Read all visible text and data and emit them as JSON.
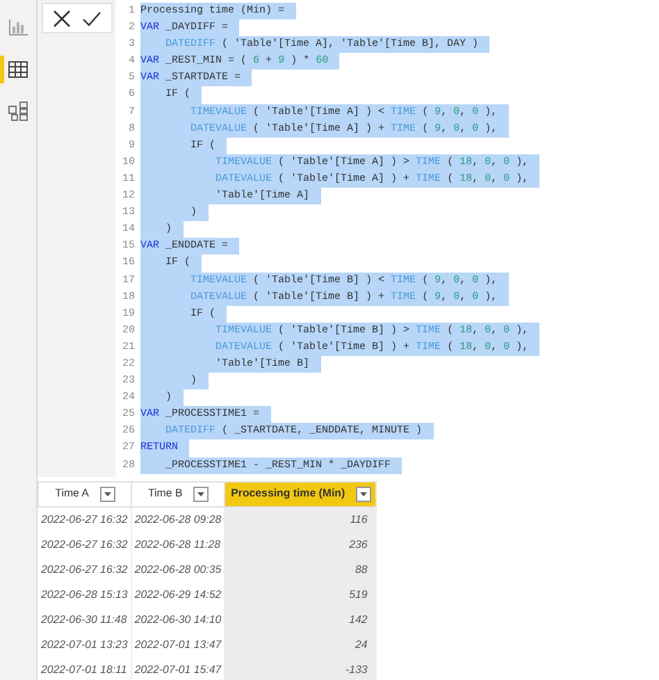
{
  "sidebar": {
    "items": [
      {
        "kind": "report",
        "selected": false
      },
      {
        "kind": "data",
        "selected": true
      },
      {
        "kind": "model",
        "selected": false
      }
    ]
  },
  "formula_bar": {
    "lines": [
      {
        "number": "1",
        "tokens": [
          {
            "kind": "text",
            "text": "Processing time (Min) ="
          }
        ]
      },
      {
        "number": "2",
        "tokens": [
          {
            "kind": "keyword",
            "text": "VAR"
          },
          {
            "kind": "text",
            "text": " _DAYDIFF ="
          }
        ]
      },
      {
        "number": "3",
        "tokens": [
          {
            "kind": "function",
            "text": "    DATEDIFF"
          },
          {
            "kind": "text",
            "text": " ( 'Table'[Time A], 'Table'[Time B], DAY )"
          }
        ]
      },
      {
        "number": "4",
        "tokens": [
          {
            "kind": "keyword",
            "text": "VAR"
          },
          {
            "kind": "text",
            "text": " _REST_MIN = ( "
          },
          {
            "kind": "number",
            "text": "6"
          },
          {
            "kind": "text",
            "text": " + "
          },
          {
            "kind": "number",
            "text": "9"
          },
          {
            "kind": "text",
            "text": " ) * "
          },
          {
            "kind": "number",
            "text": "60"
          }
        ]
      },
      {
        "number": "5",
        "tokens": [
          {
            "kind": "keyword",
            "text": "VAR"
          },
          {
            "kind": "text",
            "text": " _STARTDATE ="
          }
        ]
      },
      {
        "number": "6",
        "tokens": [
          {
            "kind": "text",
            "text": "    IF ("
          }
        ]
      },
      {
        "number": "7",
        "tokens": [
          {
            "kind": "function",
            "text": "        TIMEVALUE"
          },
          {
            "kind": "text",
            "text": " ( 'Table'[Time A] ) < "
          },
          {
            "kind": "function",
            "text": "TIME"
          },
          {
            "kind": "text",
            "text": " ( "
          },
          {
            "kind": "number",
            "text": "9"
          },
          {
            "kind": "text",
            "text": ", "
          },
          {
            "kind": "number",
            "text": "0"
          },
          {
            "kind": "text",
            "text": ", "
          },
          {
            "kind": "number",
            "text": "0"
          },
          {
            "kind": "text",
            "text": " ),"
          }
        ]
      },
      {
        "number": "8",
        "tokens": [
          {
            "kind": "function",
            "text": "        DATEVALUE"
          },
          {
            "kind": "text",
            "text": " ( 'Table'[Time A] ) + "
          },
          {
            "kind": "function",
            "text": "TIME"
          },
          {
            "kind": "text",
            "text": " ( "
          },
          {
            "kind": "number",
            "text": "9"
          },
          {
            "kind": "text",
            "text": ", "
          },
          {
            "kind": "number",
            "text": "0"
          },
          {
            "kind": "text",
            "text": ", "
          },
          {
            "kind": "number",
            "text": "0"
          },
          {
            "kind": "text",
            "text": " ),"
          }
        ]
      },
      {
        "number": "9",
        "tokens": [
          {
            "kind": "text",
            "text": "        IF ("
          }
        ]
      },
      {
        "number": "10",
        "tokens": [
          {
            "kind": "function",
            "text": "            TIMEVALUE"
          },
          {
            "kind": "text",
            "text": " ( 'Table'[Time A] ) > "
          },
          {
            "kind": "function",
            "text": "TIME"
          },
          {
            "kind": "text",
            "text": " ( "
          },
          {
            "kind": "number",
            "text": "18"
          },
          {
            "kind": "text",
            "text": ", "
          },
          {
            "kind": "number",
            "text": "0"
          },
          {
            "kind": "text",
            "text": ", "
          },
          {
            "kind": "number",
            "text": "0"
          },
          {
            "kind": "text",
            "text": " ),"
          }
        ]
      },
      {
        "number": "11",
        "tokens": [
          {
            "kind": "function",
            "text": "            DATEVALUE"
          },
          {
            "kind": "text",
            "text": " ( 'Table'[Time A] ) + "
          },
          {
            "kind": "function",
            "text": "TIME"
          },
          {
            "kind": "text",
            "text": " ( "
          },
          {
            "kind": "number",
            "text": "18"
          },
          {
            "kind": "text",
            "text": ", "
          },
          {
            "kind": "number",
            "text": "0"
          },
          {
            "kind": "text",
            "text": ", "
          },
          {
            "kind": "number",
            "text": "0"
          },
          {
            "kind": "text",
            "text": " ),"
          }
        ]
      },
      {
        "number": "12",
        "tokens": [
          {
            "kind": "text",
            "text": "            'Table'[Time A]"
          }
        ]
      },
      {
        "number": "13",
        "tokens": [
          {
            "kind": "text",
            "text": "        )"
          }
        ]
      },
      {
        "number": "14",
        "tokens": [
          {
            "kind": "text",
            "text": "    )"
          }
        ]
      },
      {
        "number": "15",
        "tokens": [
          {
            "kind": "keyword",
            "text": "VAR"
          },
          {
            "kind": "text",
            "text": " _ENDDATE ="
          }
        ]
      },
      {
        "number": "16",
        "tokens": [
          {
            "kind": "text",
            "text": "    IF ("
          }
        ]
      },
      {
        "number": "17",
        "tokens": [
          {
            "kind": "function",
            "text": "        TIMEVALUE"
          },
          {
            "kind": "text",
            "text": " ( 'Table'[Time B] ) < "
          },
          {
            "kind": "function",
            "text": "TIME"
          },
          {
            "kind": "text",
            "text": " ( "
          },
          {
            "kind": "number",
            "text": "9"
          },
          {
            "kind": "text",
            "text": ", "
          },
          {
            "kind": "number",
            "text": "0"
          },
          {
            "kind": "text",
            "text": ", "
          },
          {
            "kind": "number",
            "text": "0"
          },
          {
            "kind": "text",
            "text": " ),"
          }
        ]
      },
      {
        "number": "18",
        "tokens": [
          {
            "kind": "function",
            "text": "        DATEVALUE"
          },
          {
            "kind": "text",
            "text": " ( 'Table'[Time B] ) + "
          },
          {
            "kind": "function",
            "text": "TIME"
          },
          {
            "kind": "text",
            "text": " ( "
          },
          {
            "kind": "number",
            "text": "9"
          },
          {
            "kind": "text",
            "text": ", "
          },
          {
            "kind": "number",
            "text": "0"
          },
          {
            "kind": "text",
            "text": ", "
          },
          {
            "kind": "number",
            "text": "0"
          },
          {
            "kind": "text",
            "text": " ),"
          }
        ]
      },
      {
        "number": "19",
        "tokens": [
          {
            "kind": "text",
            "text": "        IF ("
          }
        ]
      },
      {
        "number": "20",
        "tokens": [
          {
            "kind": "function",
            "text": "            TIMEVALUE"
          },
          {
            "kind": "text",
            "text": " ( 'Table'[Time B] ) > "
          },
          {
            "kind": "function",
            "text": "TIME"
          },
          {
            "kind": "text",
            "text": " ( "
          },
          {
            "kind": "number",
            "text": "18"
          },
          {
            "kind": "text",
            "text": ", "
          },
          {
            "kind": "number",
            "text": "0"
          },
          {
            "kind": "text",
            "text": ", "
          },
          {
            "kind": "number",
            "text": "0"
          },
          {
            "kind": "text",
            "text": " ),"
          }
        ]
      },
      {
        "number": "21",
        "tokens": [
          {
            "kind": "function",
            "text": "            DATEVALUE"
          },
          {
            "kind": "text",
            "text": " ( 'Table'[Time B] ) + "
          },
          {
            "kind": "function",
            "text": "TIME"
          },
          {
            "kind": "text",
            "text": " ( "
          },
          {
            "kind": "number",
            "text": "18"
          },
          {
            "kind": "text",
            "text": ", "
          },
          {
            "kind": "number",
            "text": "0"
          },
          {
            "kind": "text",
            "text": ", "
          },
          {
            "kind": "number",
            "text": "0"
          },
          {
            "kind": "text",
            "text": " ),"
          }
        ]
      },
      {
        "number": "22",
        "tokens": [
          {
            "kind": "text",
            "text": "            'Table'[Time B]"
          }
        ]
      },
      {
        "number": "23",
        "tokens": [
          {
            "kind": "text",
            "text": "        )"
          }
        ]
      },
      {
        "number": "24",
        "tokens": [
          {
            "kind": "text",
            "text": "    )"
          }
        ]
      },
      {
        "number": "25",
        "tokens": [
          {
            "kind": "keyword",
            "text": "VAR"
          },
          {
            "kind": "text",
            "text": " _PROCESSTIME1 ="
          }
        ]
      },
      {
        "number": "26",
        "tokens": [
          {
            "kind": "function",
            "text": "    DATEDIFF"
          },
          {
            "kind": "text",
            "text": " ( _STARTDATE, _ENDDATE, MINUTE )"
          }
        ]
      },
      {
        "number": "27",
        "tokens": [
          {
            "kind": "keyword",
            "text": "RETURN"
          }
        ]
      },
      {
        "number": "28",
        "tokens": [
          {
            "kind": "text",
            "text": "    _PROCESSTIME1 - _REST_MIN * _DAYDIFF"
          }
        ]
      }
    ]
  },
  "table": {
    "columns": [
      {
        "label": "Time A",
        "selected": false
      },
      {
        "label": "Time B",
        "selected": false
      },
      {
        "label": "Processing time (Min)",
        "selected": true
      }
    ],
    "rows": [
      [
        "2022-06-27 16:32",
        "2022-06-28 09:28",
        "116"
      ],
      [
        "2022-06-27 16:32",
        "2022-06-28 11:28",
        "236"
      ],
      [
        "2022-06-27 16:32",
        "2022-06-28 00:35",
        "88"
      ],
      [
        "2022-06-28 15:13",
        "2022-06-29 14:52",
        "519"
      ],
      [
        "2022-06-30 11:48",
        "2022-06-30 14:10",
        "142"
      ],
      [
        "2022-07-01 13:23",
        "2022-07-01 13:47",
        "24"
      ],
      [
        "2022-07-01 18:11",
        "2022-07-01 15:47",
        "-133"
      ]
    ]
  }
}
